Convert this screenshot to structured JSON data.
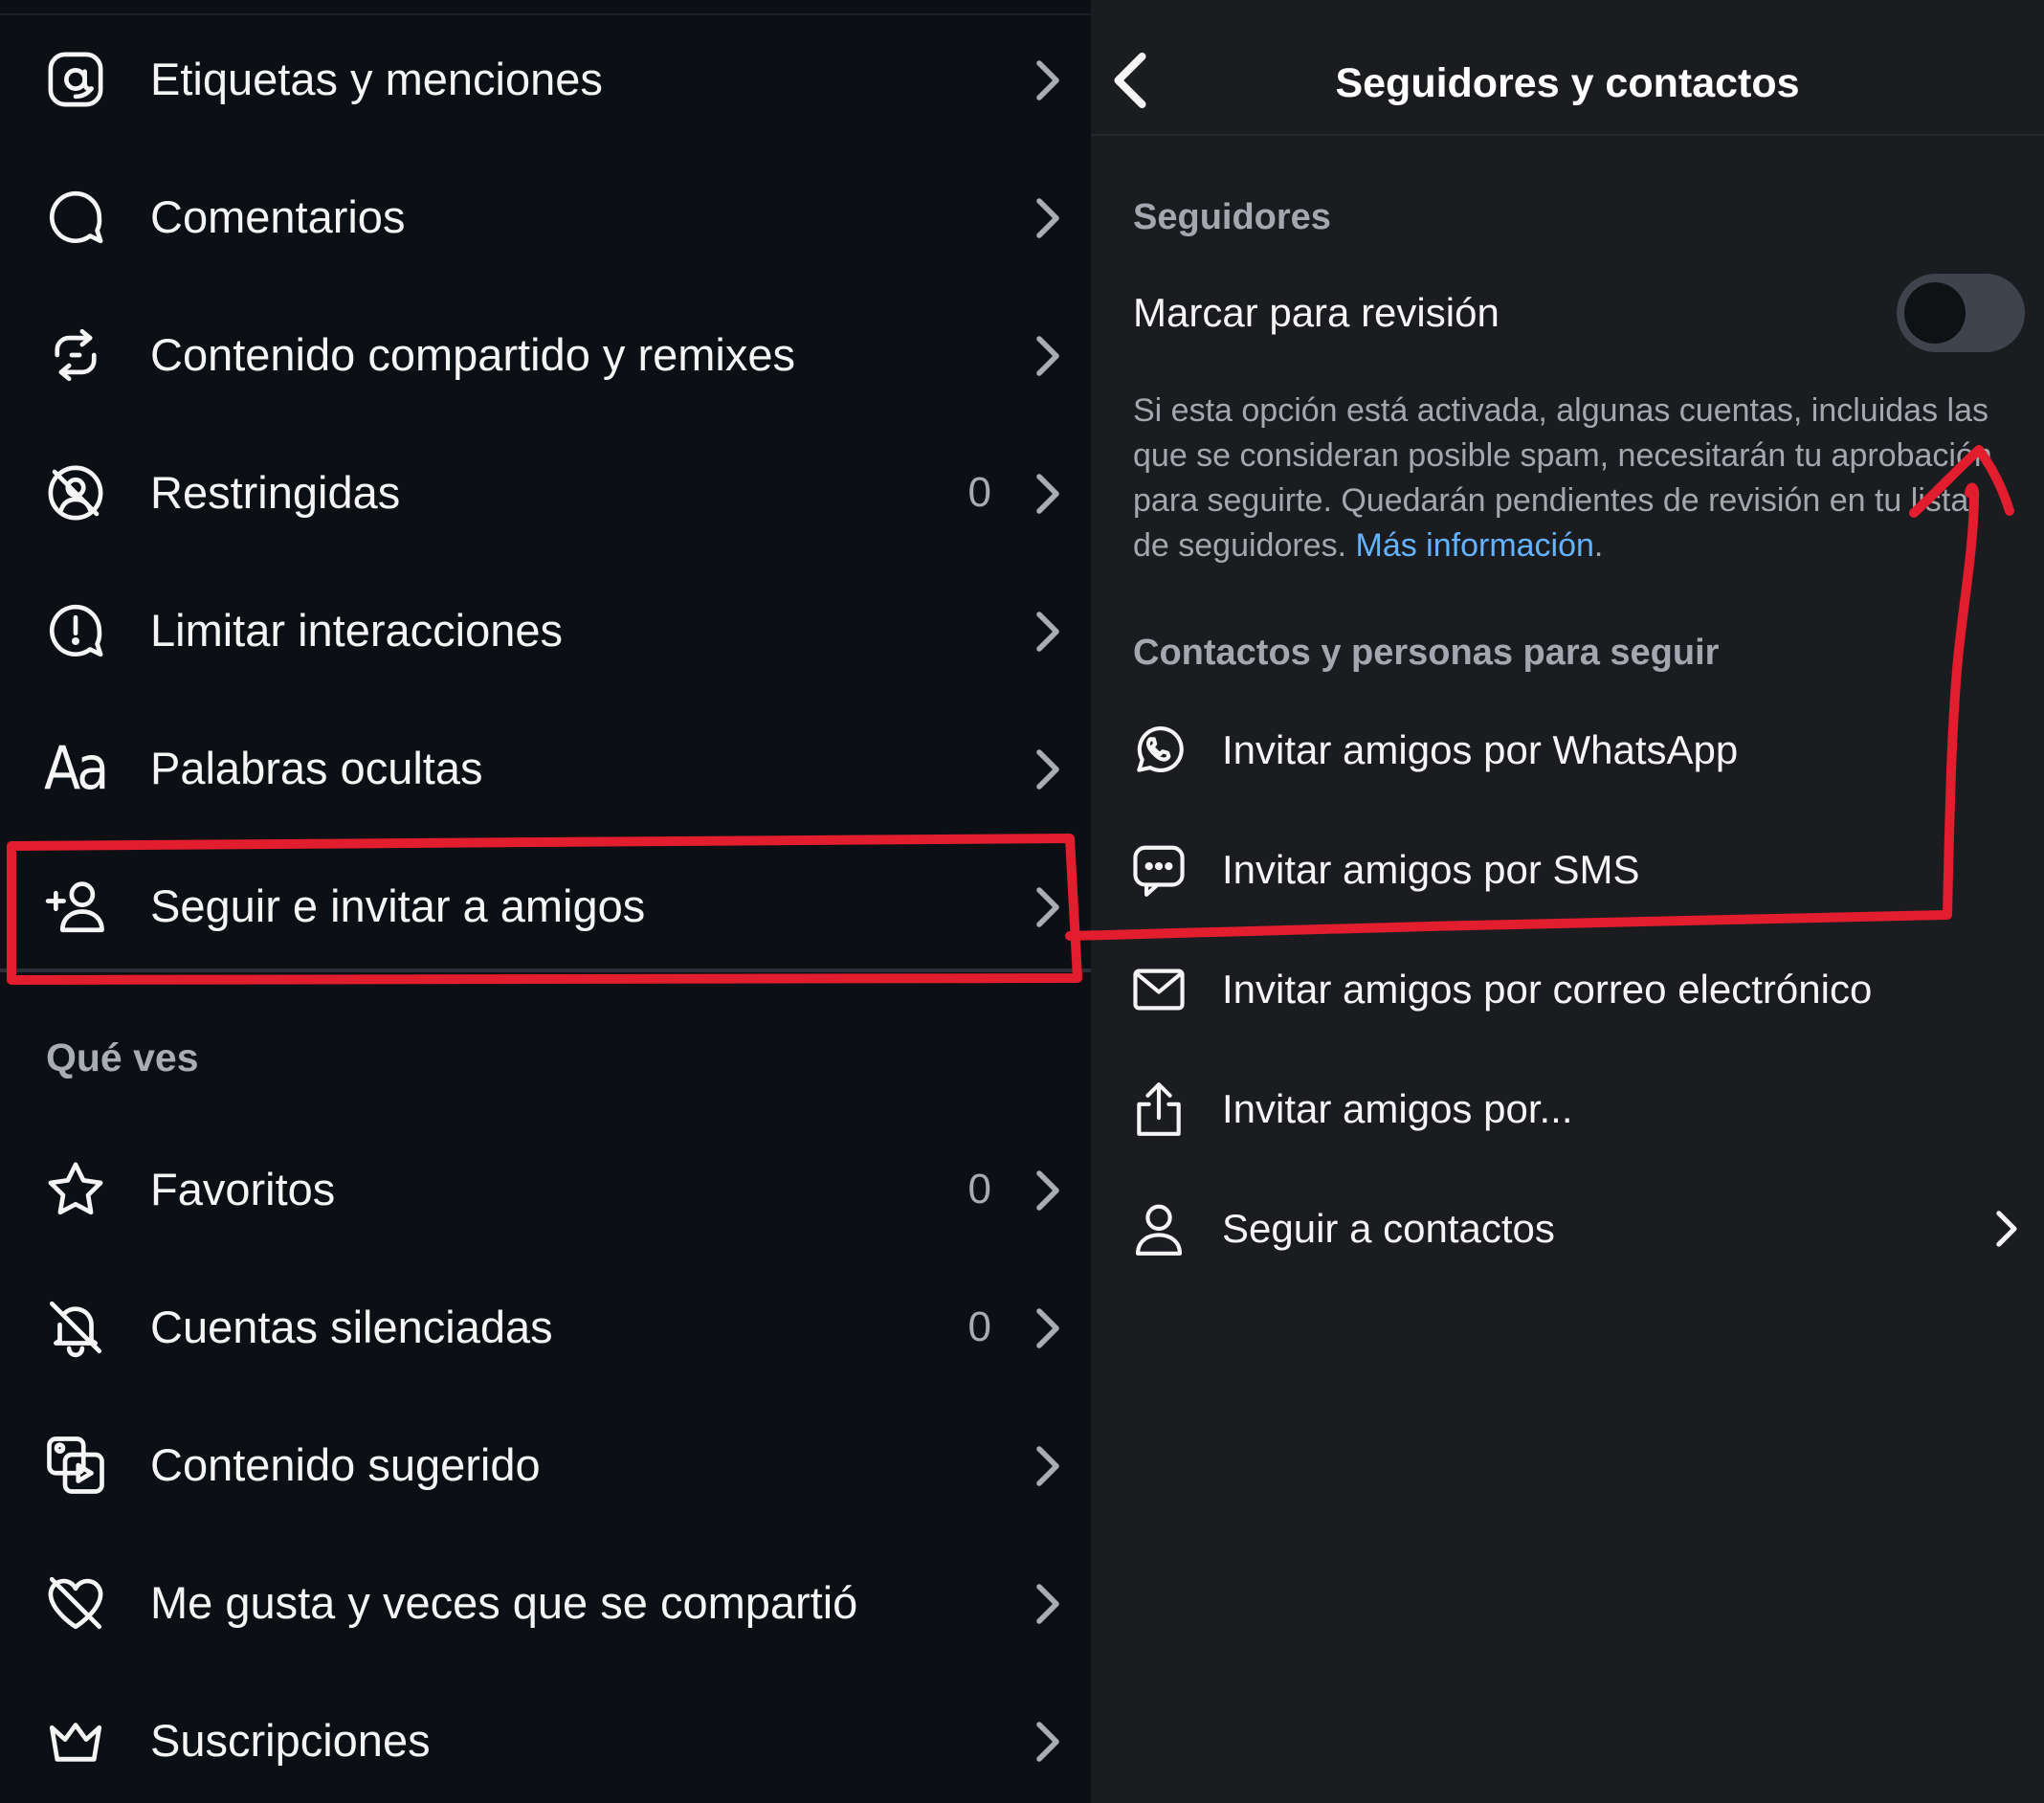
{
  "left_menu": {
    "items": [
      {
        "label": "Etiquetas y menciones",
        "count": "",
        "icon": "at-sign-icon"
      },
      {
        "label": "Comentarios",
        "count": "",
        "icon": "comment-bubble-icon"
      },
      {
        "label": "Contenido compartido y remixes",
        "count": "",
        "icon": "remix-arrows-icon"
      },
      {
        "label": "Restringidas",
        "count": "0",
        "icon": "restricted-icon"
      },
      {
        "label": "Limitar interacciones",
        "count": "",
        "icon": "alert-bubble-icon"
      },
      {
        "label": "Palabras ocultas",
        "count": "",
        "icon": "text-aa-icon"
      },
      {
        "label": "Seguir e invitar a amigos",
        "count": "",
        "icon": "add-person-icon"
      }
    ],
    "aa_glyph": "Aa",
    "section_title": "Qué ves",
    "items2": [
      {
        "label": "Favoritos",
        "count": "0",
        "icon": "star-icon"
      },
      {
        "label": "Cuentas silenciadas",
        "count": "0",
        "icon": "muted-bell-icon"
      },
      {
        "label": "Contenido sugerido",
        "count": "",
        "icon": "suggested-media-icon"
      },
      {
        "label": "Me gusta y veces que se compartió",
        "count": "",
        "icon": "heart-off-icon"
      },
      {
        "label": "Suscripciones",
        "count": "",
        "icon": "crown-icon"
      }
    ]
  },
  "right_panel": {
    "title": "Seguidores y contactos",
    "section_followers": "Seguidores",
    "toggle_label": "Marcar para revisión",
    "toggle_on": false,
    "description": "Si esta opción está activada, algunas cuentas, incluidas las que se consideran posible spam, necesitarán tu aprobación para seguirte. Quedarán pendientes de revisión en tu lista de seguidores.",
    "description_link": "Más información",
    "description_end": ".",
    "section_contacts": "Contactos y personas para seguir",
    "invites": [
      {
        "label": "Invitar amigos por WhatsApp",
        "icon": "whatsapp-icon"
      },
      {
        "label": "Invitar amigos por SMS",
        "icon": "sms-bubble-icon"
      },
      {
        "label": "Invitar amigos por correo electrónico",
        "icon": "envelope-icon"
      },
      {
        "label": "Invitar amigos por...",
        "icon": "share-upload-icon"
      },
      {
        "label": "Seguir a contactos",
        "icon": "person-icon"
      }
    ]
  },
  "colors": {
    "annotation_red": "#e11d2e",
    "link_blue": "#63b3ff",
    "left_bg": "#0c0f14",
    "right_bg": "#1b1c20"
  }
}
